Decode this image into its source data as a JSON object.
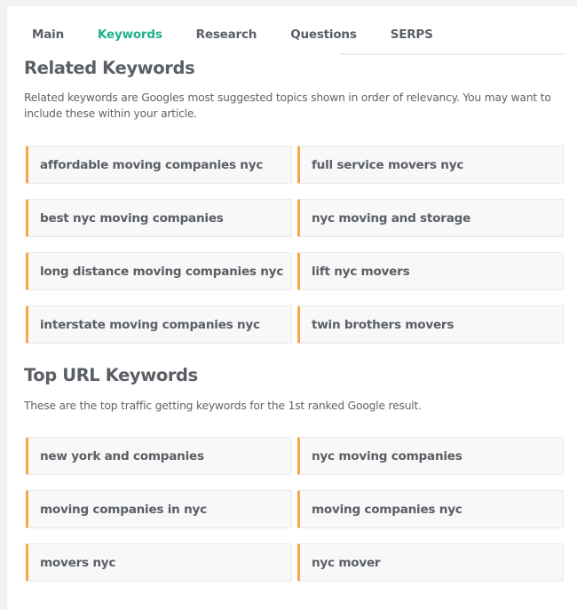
{
  "tabs": [
    {
      "label": "Main",
      "active": false
    },
    {
      "label": "Keywords",
      "active": true
    },
    {
      "label": "Research",
      "active": false
    },
    {
      "label": "Questions",
      "active": false
    },
    {
      "label": "SERPS",
      "active": false
    }
  ],
  "colors": {
    "accent": "#1fb08d",
    "card_marker": "#f9a64b",
    "card_background": "#f8f8f9",
    "text": "#5a5f66"
  },
  "related_keywords": {
    "title": "Related Keywords",
    "description": "Related keywords are Googles most suggested topics shown in order of relevancy. You may want to include these within your article.",
    "items": [
      "affordable moving companies nyc",
      "full service movers nyc",
      "best nyc moving companies",
      "nyc moving and storage",
      "long distance moving companies nyc",
      "lift nyc movers",
      "interstate moving companies nyc",
      "twin brothers movers"
    ]
  },
  "top_url_keywords": {
    "title": "Top URL Keywords",
    "description": "These are the top traffic getting keywords for the 1st ranked Google result.",
    "items": [
      "new york and companies",
      "nyc moving companies",
      "moving companies in nyc",
      "moving companies nyc",
      "movers nyc",
      "nyc mover"
    ]
  }
}
